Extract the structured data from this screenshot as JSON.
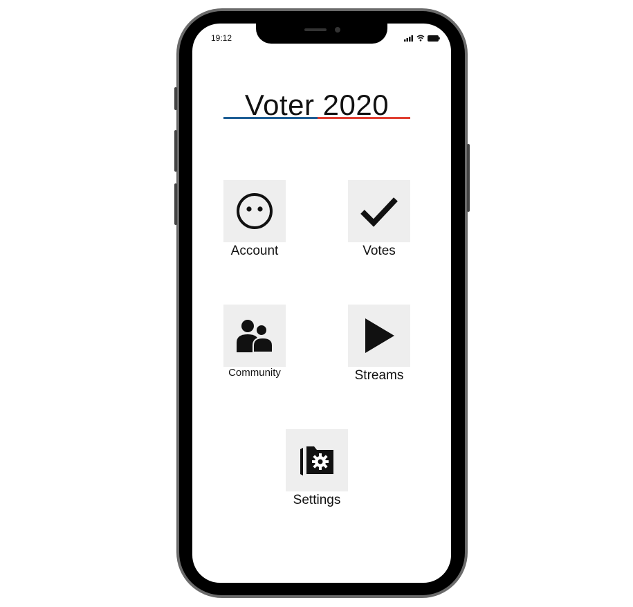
{
  "status_bar": {
    "time": "19:12"
  },
  "app": {
    "title": "Voter 2020"
  },
  "menu": {
    "account_label": "Account",
    "votes_label": "Votes",
    "community_label": "Community",
    "streams_label": "Streams",
    "settings_label": "Settings"
  },
  "icons": {
    "account": "smiley-face-icon",
    "votes": "checkmark-icon",
    "community": "people-group-icon",
    "streams": "play-icon",
    "settings": "folder-settings-icon"
  },
  "colors": {
    "accent_blue": "#1f5f96",
    "accent_red": "#e04033",
    "tile_bg": "#eeeeee"
  }
}
